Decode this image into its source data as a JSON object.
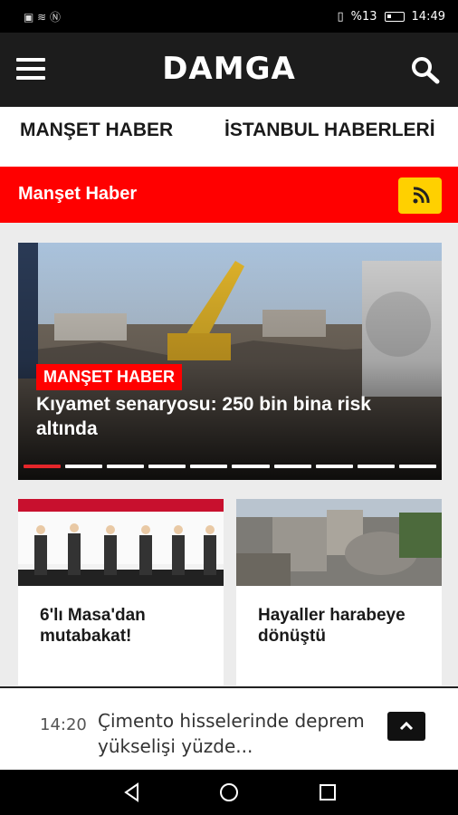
{
  "status": {
    "time": "14:49",
    "battery": "%13",
    "left_icons": "▣ ≋ Ⓝ"
  },
  "header": {
    "logo": "DAMGA"
  },
  "tabs": [
    "MANŞET HABER",
    "İSTANBUL HABERLERİ"
  ],
  "section": {
    "title": "Manşet Haber"
  },
  "hero": {
    "badge": "MANŞET HABER",
    "title": "Kıyamet senaryosu: 250 bin bina risk altında",
    "slides": 10,
    "active_slide": 1
  },
  "cards": [
    {
      "title": "6'lı Masa'dan mutabakat!"
    },
    {
      "title": "Hayaller harabeye dönüştü"
    }
  ],
  "ticker": {
    "time": "14:20",
    "text": "Çimento hisselerinde deprem yükselişi yüzde..."
  },
  "colors": {
    "brand_red": "#ff0000",
    "rss_yellow": "#ffd000",
    "topbar": "#1c1c1c"
  }
}
